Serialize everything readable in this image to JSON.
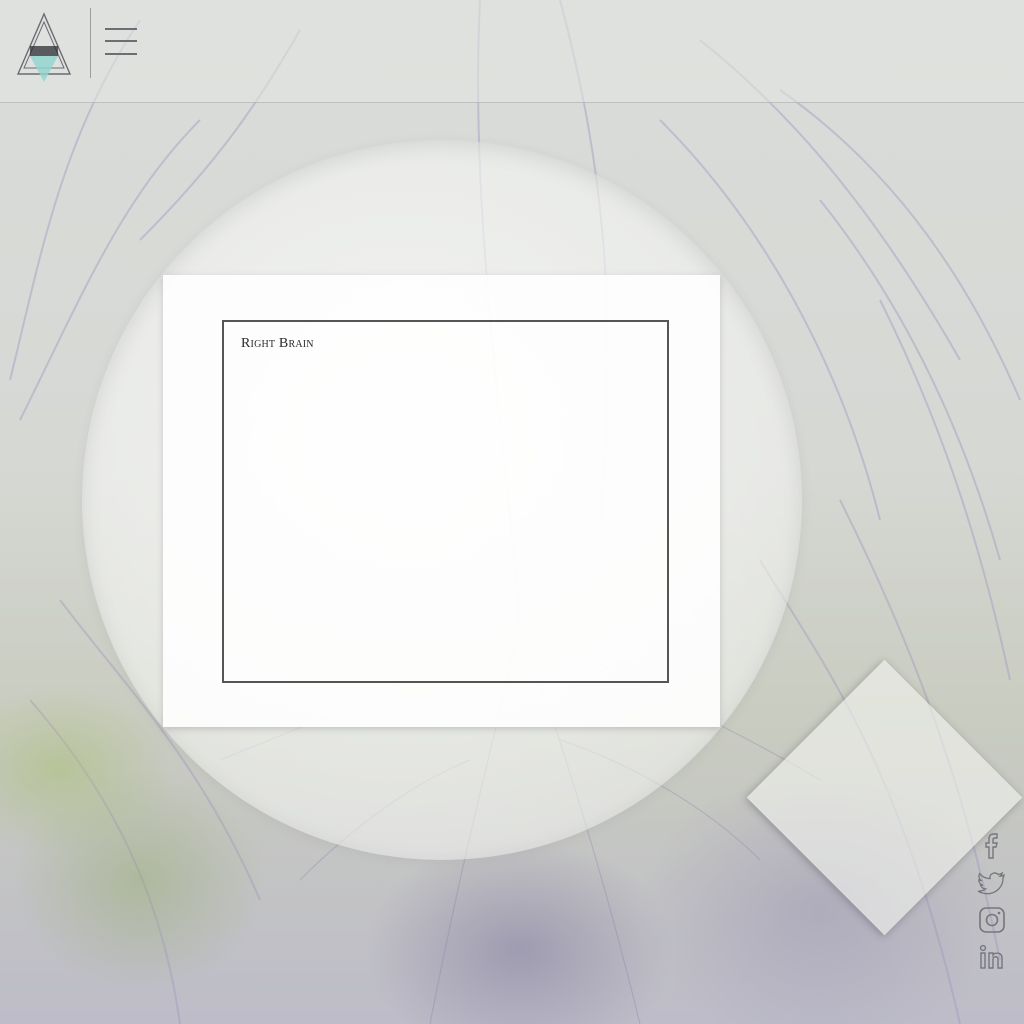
{
  "page": {
    "theme_colors": {
      "background": "#d7d9d6",
      "hair_lavender": "#a7a0c4",
      "card": "#ffffff",
      "frame": "#555555",
      "icon": "#76767c"
    }
  },
  "header": {
    "logo_icon": "triangle-logo-icon",
    "menu_icon": "hamburger-menu-icon"
  },
  "content_card": {
    "title": "Right Brain"
  },
  "social": {
    "items": [
      {
        "icon": "facebook-icon"
      },
      {
        "icon": "twitter-icon"
      },
      {
        "icon": "instagram-icon"
      },
      {
        "icon": "linkedin-icon"
      }
    ]
  }
}
